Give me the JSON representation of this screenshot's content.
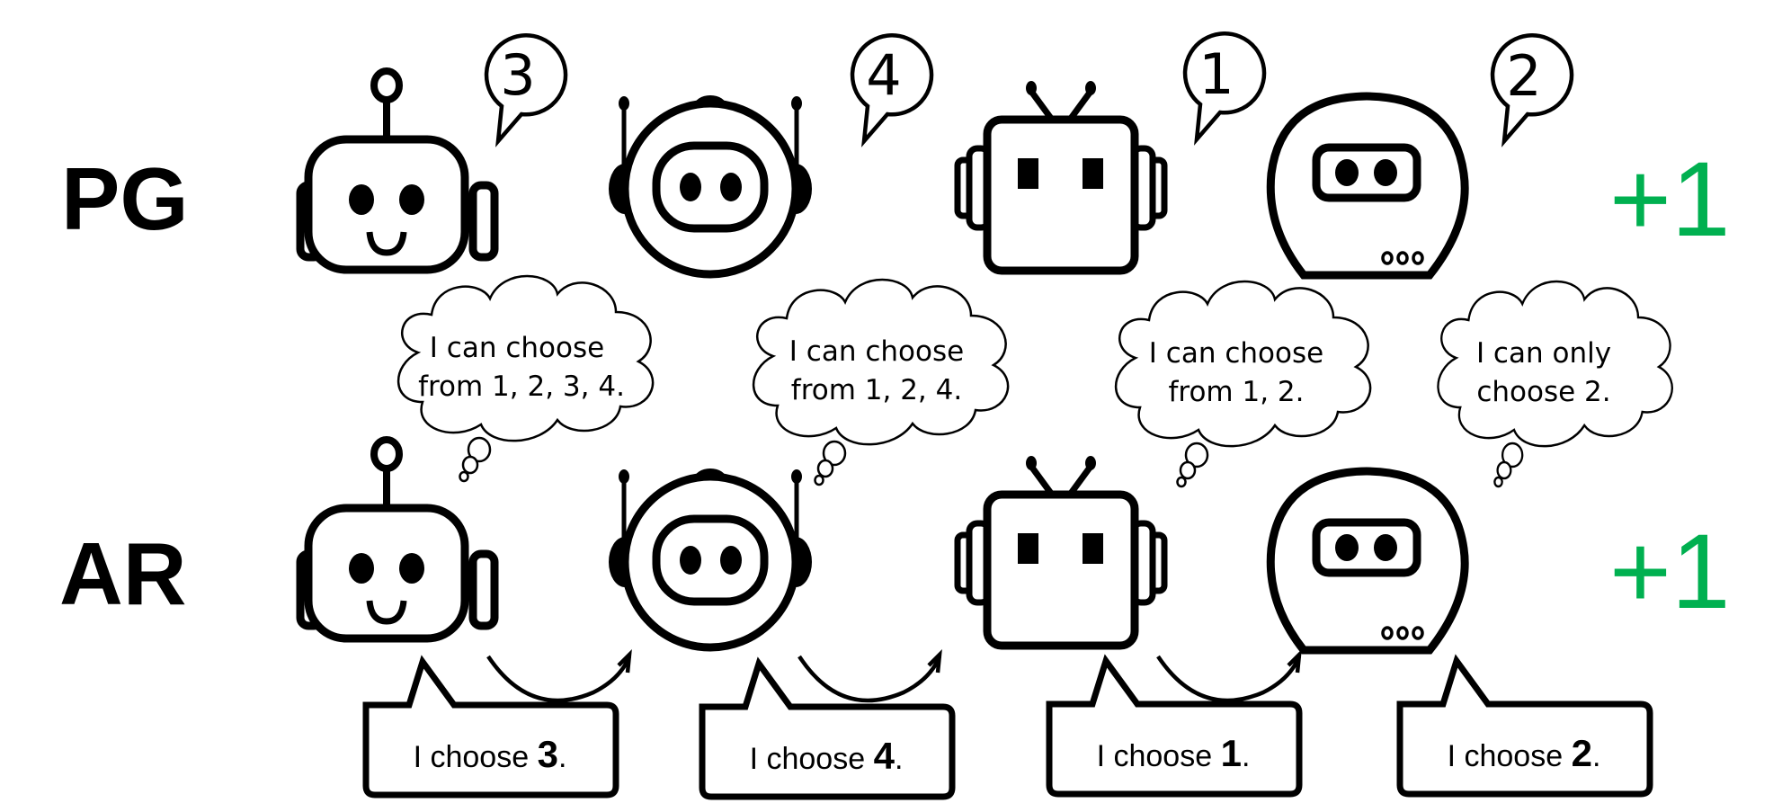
{
  "rows": [
    {
      "label": "PG",
      "reward": "+1"
    },
    {
      "label": "AR",
      "reward": "+1"
    }
  ],
  "colors": {
    "reward": "#00b050",
    "ink": "#000000",
    "background": "#ffffff"
  },
  "robots": [
    {
      "style": "round-antenna-smile",
      "pg_choice": "3",
      "ar_thought_line1": "I can choose",
      "ar_thought_line2": "from 1, 2, 3, 4.",
      "ar_say_prefix": "I choose ",
      "ar_say_num": "3",
      "ar_say_suffix": "."
    },
    {
      "style": "oval-headphones",
      "pg_choice": "4",
      "ar_thought_line1": "I can choose",
      "ar_thought_line2": "from 1, 2, 4.",
      "ar_say_prefix": "I choose ",
      "ar_say_num": "4",
      "ar_say_suffix": "."
    },
    {
      "style": "square-tv",
      "pg_choice": "1",
      "ar_thought_line1": "I can choose",
      "ar_thought_line2": "from 1, 2.",
      "ar_say_prefix": "I choose ",
      "ar_say_num": "1",
      "ar_say_suffix": "."
    },
    {
      "style": "egg-visor",
      "pg_choice": "2",
      "ar_thought_line1": "I can only",
      "ar_thought_line2": "choose 2.",
      "ar_say_prefix": "I choose ",
      "ar_say_num": "2",
      "ar_say_suffix": "."
    }
  ]
}
